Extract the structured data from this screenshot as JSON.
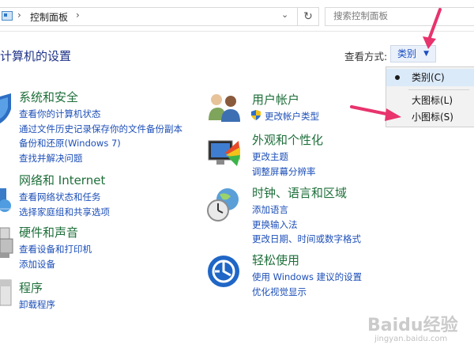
{
  "address_bar": {
    "breadcrumb": "控制面板",
    "separator": "›",
    "search_placeholder": "搜索控制面板"
  },
  "page": {
    "title": "计算机的设置",
    "view_by_label": "查看方式:",
    "view_by_value": "类别"
  },
  "view_menu": {
    "items": [
      "类别(C)",
      "大图标(L)",
      "小图标(S)"
    ],
    "selected": "类别(C)"
  },
  "categories": [
    {
      "title": "系统和安全",
      "links": [
        "查看你的计算机状态",
        "通过文件历史记录保存你的文件备份副本",
        "备份和还原(Windows 7)",
        "查找并解决问题"
      ]
    },
    {
      "title": "网络和 Internet",
      "links": [
        "查看网络状态和任务",
        "选择家庭组和共享选项"
      ]
    },
    {
      "title": "硬件和声音",
      "links": [
        "查看设备和打印机",
        "添加设备"
      ]
    },
    {
      "title": "程序",
      "links": [
        "卸载程序"
      ]
    },
    {
      "title": "用户帐户",
      "links": [
        "更改帐户类型"
      ]
    },
    {
      "title": "外观和个性化",
      "links": [
        "更改主题",
        "调整屏幕分辨率"
      ]
    },
    {
      "title": "时钟、语言和区域",
      "links": [
        "添加语言",
        "更换输入法",
        "更改日期、时间或数字格式"
      ]
    },
    {
      "title": "轻松使用",
      "links": [
        "使用 Windows 建议的设置",
        "优化视觉显示"
      ]
    }
  ],
  "colors": {
    "category_title": "#1e6f3a",
    "link": "#1d4fb8",
    "page_title": "#1e3287",
    "annotation_arrow": "#e8336d"
  },
  "watermark": {
    "logo": "Baidu经验",
    "url": "jingyan.baidu.com"
  }
}
